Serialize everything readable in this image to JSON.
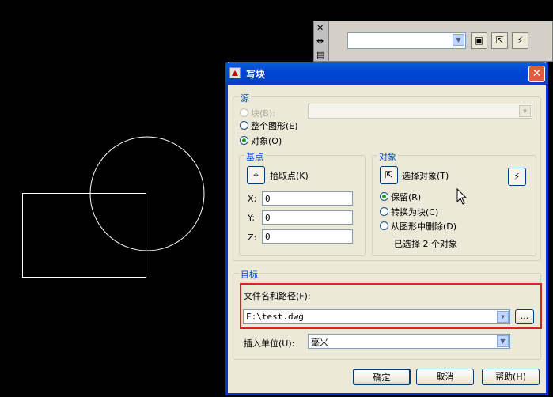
{
  "palette": {
    "close": "✕",
    "pin": "⇹",
    "props": "▤"
  },
  "dialog": {
    "title": "写块",
    "close_glyph": "✕",
    "source": {
      "label": "源",
      "block": "块(B):",
      "entire": "整个图形(E)",
      "objects": "对象(O)",
      "selected": "objects"
    },
    "basepoint": {
      "label": "基点",
      "pick": "拾取点(K)",
      "x_label": "X:",
      "x": "0",
      "y_label": "Y:",
      "y": "0",
      "z_label": "Z:",
      "z": "0"
    },
    "objects": {
      "label": "对象",
      "select": "选择对象(T)",
      "retain": "保留(R)",
      "convert": "转换为块(C)",
      "delete": "从图形中删除(D)",
      "selected": "retain",
      "status": "已选择 2 个对象"
    },
    "destination": {
      "label": "目标",
      "path_label": "文件名和路径(F):",
      "path_value": "F:\\test.dwg",
      "browse": "...",
      "units_label": "插入单位(U):",
      "units_value": "毫米"
    },
    "buttons": {
      "ok": "确定",
      "cancel": "取消",
      "help": "帮助(H)"
    }
  },
  "colors": {
    "title_blue": "#0046d5",
    "dialog_bg": "#ece9d8",
    "highlight": "#d9251d"
  }
}
